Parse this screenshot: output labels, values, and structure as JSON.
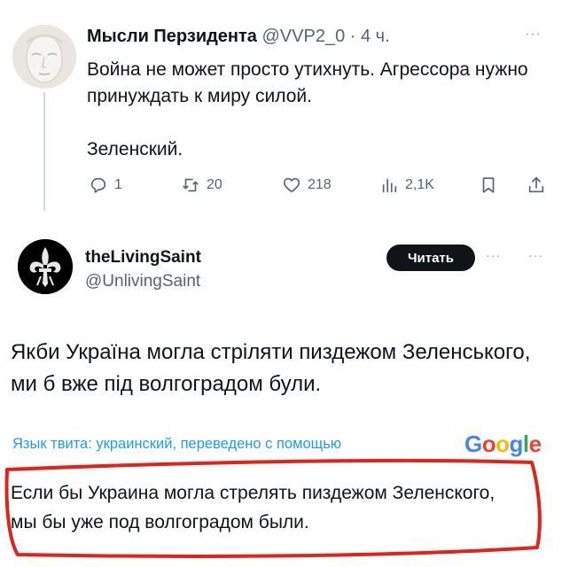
{
  "tweet": {
    "author_name": "Мысли Перзидента",
    "handle": "@VVP2_0",
    "separator": " · ",
    "time": "4 ч.",
    "more_icon": "more-dots-icon",
    "text_line1": "Война не может просто утихнуть. Агрессора нужно принуждать к миру силой.",
    "signature": "Зеленский.",
    "actions": {
      "reply_count": "1",
      "retweet_count": "20",
      "like_count": "218",
      "views_count": "2,1K"
    }
  },
  "quoted": {
    "author_name": "theLivingSaint",
    "handle": "@UnlivingSaint",
    "follow_label": "Читать",
    "original_text": "Якби Україна могла стріляти пиздежом Зеленського, ми б вже під волгоградом були.",
    "translation_note": "Язык твита: украинский, переведено с помощью",
    "translation_provider": "Google",
    "translated_text": "Если бы Украина могла стрелять пиздежом Зеленского, мы бы уже под волгоградом были."
  },
  "colors": {
    "link_blue": "#1d9bf0",
    "secondary_text": "#536471",
    "annotation_red": "#e0231b",
    "google_blue": "#4285f4",
    "google_red": "#ea4335",
    "google_yellow": "#fbbc05",
    "google_green": "#34a853"
  }
}
